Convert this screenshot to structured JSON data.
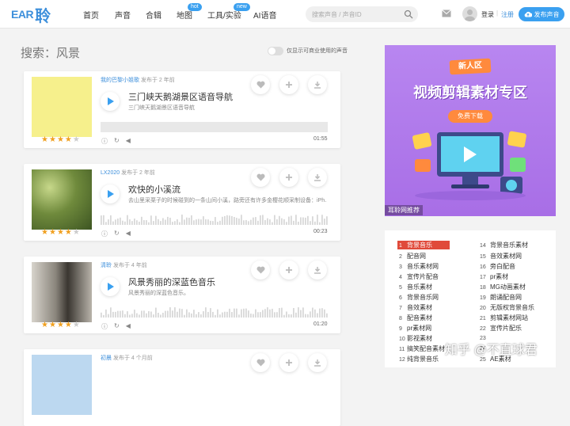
{
  "logo": {
    "text1": "EAR",
    "text2": "聆"
  },
  "nav": [
    {
      "label": "首页"
    },
    {
      "label": "声音"
    },
    {
      "label": "合辑"
    },
    {
      "label": "地图",
      "badge": "hot"
    },
    {
      "label": "工具/实验",
      "badge": "new"
    },
    {
      "label": "AI语音"
    }
  ],
  "search": {
    "placeholder": "搜索声音 / 声音ID"
  },
  "header": {
    "login": "登录",
    "sep": "|",
    "register": "注册",
    "upload": "发布声音"
  },
  "page": {
    "title": "搜索：风景",
    "toggle_label": "仅显示可商业使用的声音"
  },
  "sounds": [
    {
      "author": "我的巴黎小姐歌",
      "posted": "发布于 2 年前",
      "title": "三门峡天鹅湖景区语音导航",
      "desc": "三门峡天鹅湖景区语音导航",
      "duration": "01:55",
      "rating": 4,
      "thumb_color": "#f6f08c"
    },
    {
      "author": "LX2020",
      "posted": "发布于 2 年前",
      "title": "欢快的小溪流",
      "desc": "去山里采栗子的时候碰到的一条山间小溪，路旁还有许多金樱花顺采制设备：iPh…",
      "duration": "00:23",
      "rating": 4,
      "thumb_color": "#6f8a3c"
    },
    {
      "author": "清聆",
      "posted": "发布于 4 年前",
      "title": "风景秀丽的深蓝色音乐",
      "desc": "风景秀丽的深蓝色音乐。",
      "duration": "01:20",
      "rating": 4,
      "thumb_color": "#9a968e"
    },
    {
      "author": "初晨",
      "posted": "发布于 4 个月前",
      "title": "",
      "desc": "",
      "duration": "",
      "rating": 0,
      "thumb_color": "#bcd8f0"
    }
  ],
  "ad": {
    "badge": "新人区",
    "title": "视频剪辑素材专区",
    "button": "免费下载",
    "caption": "耳聆网推荐",
    "bg": "#b07ae8"
  },
  "tags_left": [
    {
      "n": "1",
      "label": "背景音乐"
    },
    {
      "n": "2",
      "label": "配音网"
    },
    {
      "n": "3",
      "label": "音乐素材网"
    },
    {
      "n": "4",
      "label": "宣传片配音"
    },
    {
      "n": "5",
      "label": "音乐素材"
    },
    {
      "n": "6",
      "label": "背景音乐网"
    },
    {
      "n": "7",
      "label": "音效素材"
    },
    {
      "n": "8",
      "label": "配音素材"
    },
    {
      "n": "9",
      "label": "pr素材网"
    },
    {
      "n": "10",
      "label": "影视素材"
    },
    {
      "n": "11",
      "label": "搞笑配音素材"
    },
    {
      "n": "12",
      "label": "纯背景音乐"
    }
  ],
  "tags_right": [
    {
      "n": "14",
      "label": "背景音乐素材"
    },
    {
      "n": "15",
      "label": "音效素材网"
    },
    {
      "n": "16",
      "label": "旁白配音"
    },
    {
      "n": "17",
      "label": "pr素材"
    },
    {
      "n": "18",
      "label": "MG动画素材"
    },
    {
      "n": "19",
      "label": "朗诵配音网"
    },
    {
      "n": "20",
      "label": "无版权背景音乐"
    },
    {
      "n": "21",
      "label": "剪辑素材网站"
    },
    {
      "n": "22",
      "label": "宣传片配乐"
    },
    {
      "n": "23",
      "label": ""
    },
    {
      "n": "24",
      "label": ""
    },
    {
      "n": "25",
      "label": "AE素材"
    }
  ],
  "watermark": "知乎 @不直球君"
}
